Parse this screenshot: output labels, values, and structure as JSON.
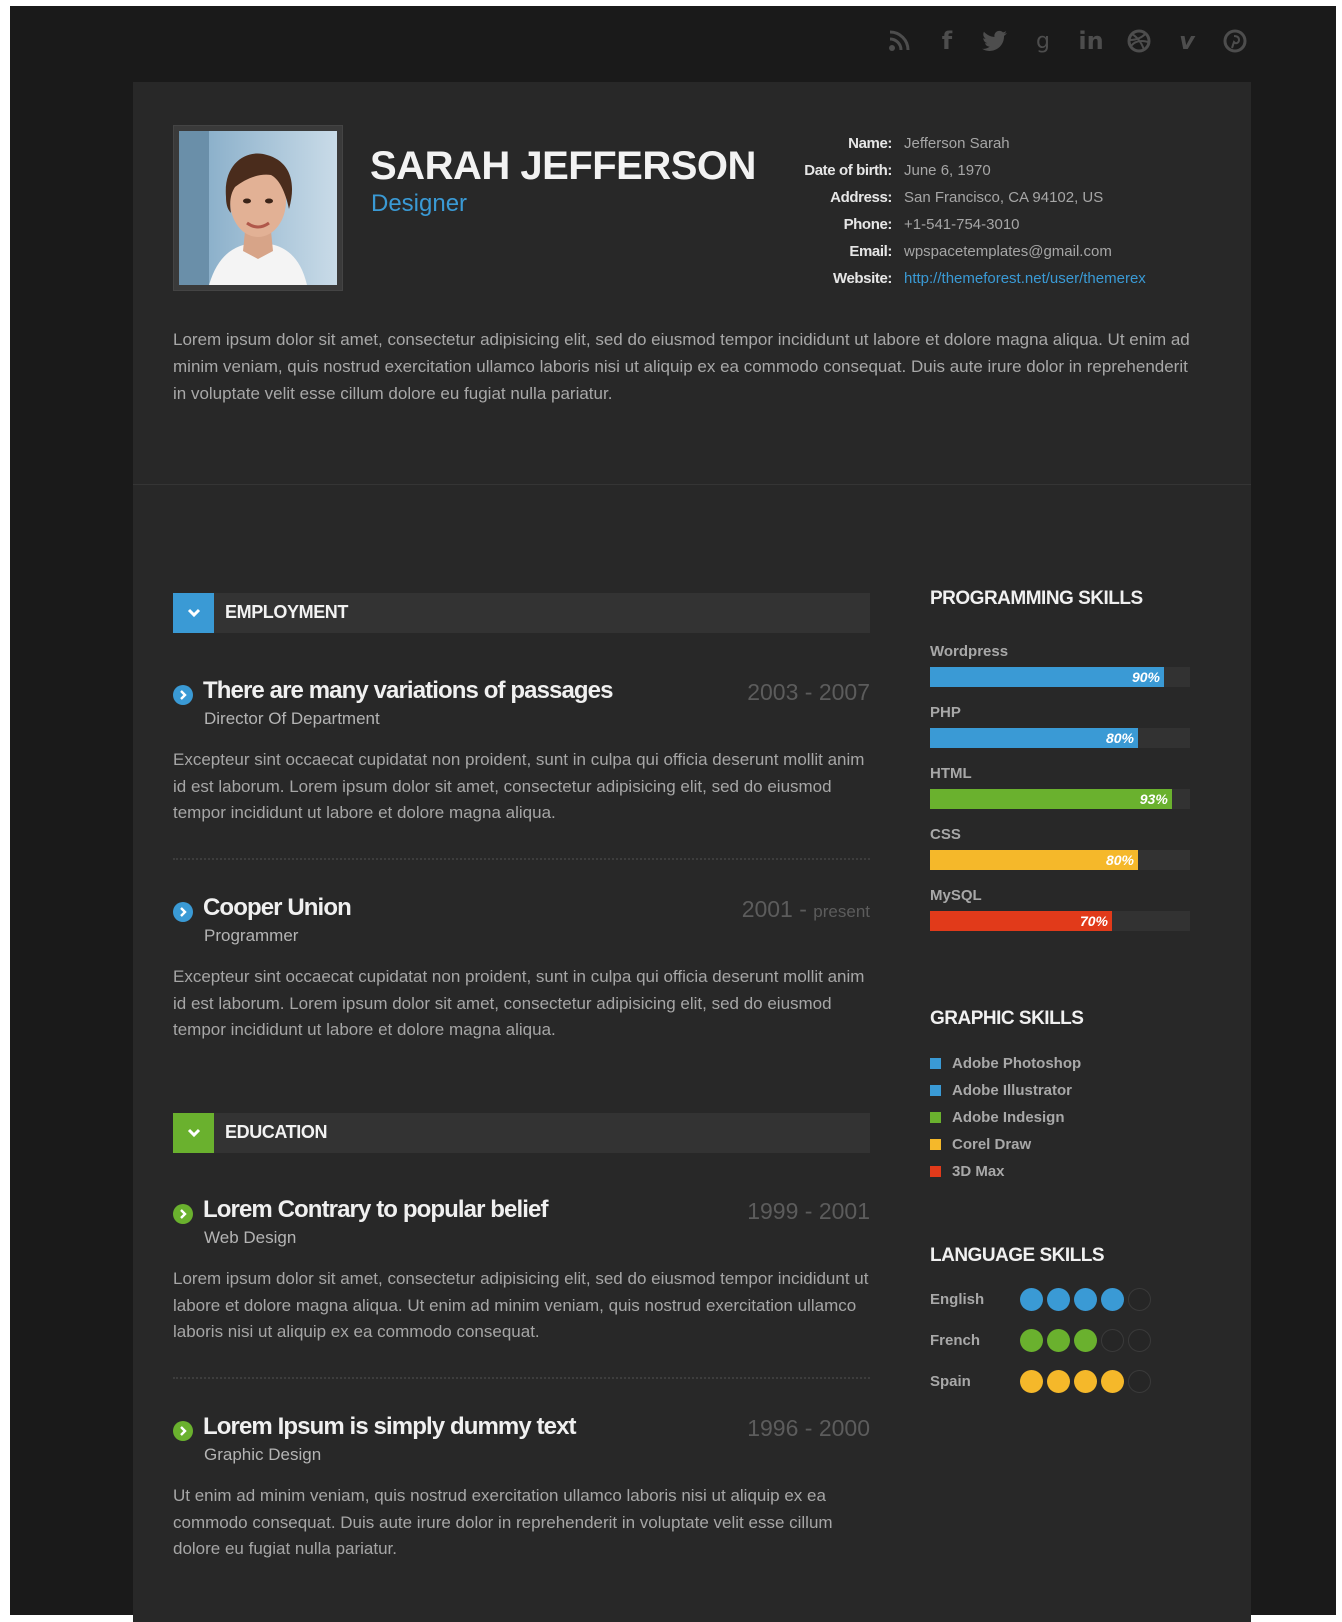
{
  "colors": {
    "accent_blue": "#3a9ad5",
    "green": "#6ab12e",
    "yellow": "#f5b82a",
    "red": "#e13a1a"
  },
  "social_icons": [
    "rss-icon",
    "facebook-icon",
    "twitter-icon",
    "google-plus-icon",
    "linkedin-icon",
    "dribbble-icon",
    "vimeo-icon",
    "pinterest-icon"
  ],
  "profile": {
    "name": "SARAH JEFFERSON",
    "role": "Designer",
    "info": [
      {
        "label": "Name:",
        "value": "Jefferson Sarah"
      },
      {
        "label": "Date of birth:",
        "value": "June 6, 1970"
      },
      {
        "label": "Address:",
        "value": "San Francisco, CA 94102, US"
      },
      {
        "label": "Phone:",
        "value": "+1-541-754-3010"
      },
      {
        "label": "Email:",
        "value": "wpspacetemplates@gmail.com"
      },
      {
        "label": "Website:",
        "value": "http://themeforest.net/user/themerex"
      }
    ],
    "intro": "Lorem ipsum dolor sit amet, consectetur adipisicing elit, sed do eiusmod tempor incididunt ut labore et dolore magna aliqua. Ut enim ad minim veniam, quis nostrud exercitation ullamco laboris nisi ut aliquip ex ea commodo consequat. Duis aute irure dolor in reprehenderit in voluptate velit esse cillum dolore eu fugiat nulla pariatur."
  },
  "employment": {
    "heading": "EMPLOYMENT",
    "entries": [
      {
        "title": "There are many variations of passages",
        "date": "2003 - 2007",
        "subtitle": "Director Of Department",
        "desc": "Excepteur sint occaecat cupidatat non proident, sunt in culpa qui officia deserunt mollit anim id est laborum. Lorem ipsum dolor sit amet, consectetur adipisicing elit, sed do eiusmod tempor incididunt ut labore et dolore magna aliqua."
      },
      {
        "title": "Cooper Union",
        "date": "2001 -",
        "date_small": "present",
        "subtitle": "Programmer",
        "desc": "Excepteur sint occaecat cupidatat non proident, sunt in culpa qui officia deserunt mollit anim id est laborum. Lorem ipsum dolor sit amet, consectetur adipisicing elit, sed do eiusmod tempor incididunt ut labore et dolore magna aliqua."
      }
    ]
  },
  "education": {
    "heading": "EDUCATION",
    "entries": [
      {
        "title": "Lorem Contrary to popular belief",
        "date": "1999 - 2001",
        "subtitle": "Web Design",
        "desc": "Lorem ipsum dolor sit amet, consectetur adipisicing elit, sed do eiusmod tempor incididunt ut labore et dolore magna aliqua. Ut enim ad minim veniam, quis nostrud exercitation ullamco laboris nisi ut aliquip ex ea commodo consequat."
      },
      {
        "title": "Lorem Ipsum is simply dummy text",
        "date": "1996 - 2000",
        "subtitle": "Graphic Design",
        "desc": "Ut enim ad minim veniam, quis nostrud exercitation ullamco laboris nisi ut aliquip ex ea commodo consequat. Duis aute irure dolor in reprehenderit in voluptate velit esse cillum dolore eu fugiat nulla pariatur."
      }
    ]
  },
  "programming_skills": {
    "heading": "PROGRAMMING SKILLS",
    "items": [
      {
        "label": "Wordpress",
        "percent": 90,
        "percent_label": "90%",
        "color": "#3a9ad5"
      },
      {
        "label": "PHP",
        "percent": 80,
        "percent_label": "80%",
        "color": "#3a9ad5"
      },
      {
        "label": "HTML",
        "percent": 93,
        "percent_label": "93%",
        "color": "#6ab12e"
      },
      {
        "label": "CSS",
        "percent": 80,
        "percent_label": "80%",
        "color": "#f5b82a"
      },
      {
        "label": "MySQL",
        "percent": 70,
        "percent_label": "70%",
        "color": "#e13a1a"
      }
    ]
  },
  "graphic_skills": {
    "heading": "GRAPHIC SKILLS",
    "items": [
      {
        "label": "Adobe Photoshop",
        "color": "#3a9ad5"
      },
      {
        "label": "Adobe Illustrator",
        "color": "#3a9ad5"
      },
      {
        "label": "Adobe Indesign",
        "color": "#6ab12e"
      },
      {
        "label": "Corel Draw",
        "color": "#f5b82a"
      },
      {
        "label": "3D Max",
        "color": "#e13a1a"
      }
    ]
  },
  "language_skills": {
    "heading": "LANGUAGE SKILLS",
    "items": [
      {
        "label": "English",
        "level": 4,
        "max": 5,
        "color": "#3a9ad5"
      },
      {
        "label": "French",
        "level": 3,
        "max": 5,
        "color": "#6ab12e"
      },
      {
        "label": "Spain",
        "level": 4,
        "max": 5,
        "color": "#f5b82a"
      }
    ]
  }
}
